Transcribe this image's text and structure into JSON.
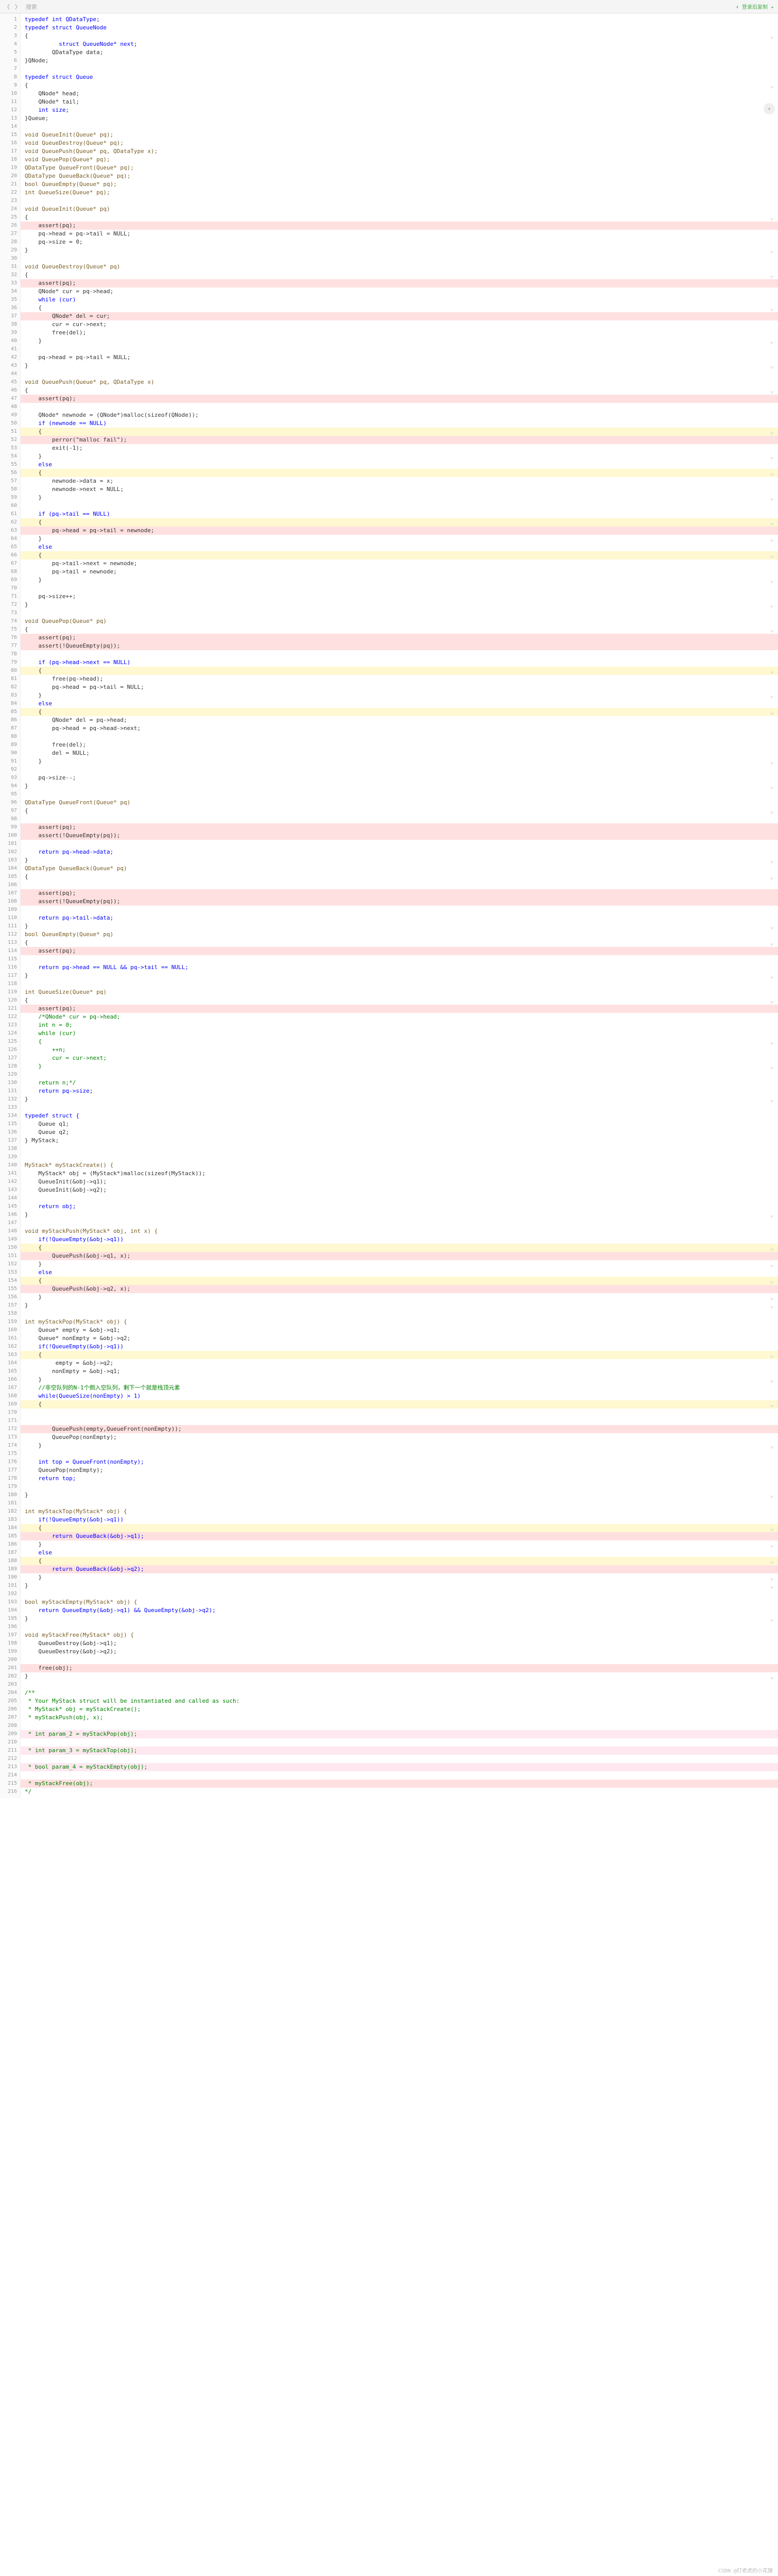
{
  "topbar": {
    "back": "〈",
    "fwd": "〉",
    "search": "搜索",
    "right": "⬇ 登录后复制   ✦"
  },
  "badge": "✦",
  "footer": "CSDN @打老虎的小花狸",
  "code": [
    {
      "n": 1,
      "t": "typedef int QDataType;",
      "c": "kw"
    },
    {
      "n": 2,
      "t": "typedef struct QueueNode",
      "c": "kw"
    },
    {
      "n": 3,
      "t": "{",
      "c": ""
    },
    {
      "n": 4,
      "t": "          struct QueueNode* next;",
      "c": "kw"
    },
    {
      "n": 5,
      "t": "        QDataType data;",
      "c": ""
    },
    {
      "n": 6,
      "t": "}QNode;",
      "c": ""
    },
    {
      "n": 7,
      "t": "",
      "c": ""
    },
    {
      "n": 8,
      "t": "typedef struct Queue",
      "c": "kw"
    },
    {
      "n": 9,
      "t": "{",
      "c": ""
    },
    {
      "n": 10,
      "t": "    QNode* head;",
      "c": ""
    },
    {
      "n": 11,
      "t": "    QNode* tail;",
      "c": ""
    },
    {
      "n": 12,
      "t": "    int size;",
      "c": "kw"
    },
    {
      "n": 13,
      "t": "}Queue;",
      "c": ""
    },
    {
      "n": 14,
      "t": "",
      "c": ""
    },
    {
      "n": 15,
      "t": "void QueueInit(Queue* pq);",
      "c": "fn"
    },
    {
      "n": 16,
      "t": "void QueueDestroy(Queue* pq);",
      "c": "fn"
    },
    {
      "n": 17,
      "t": "void QueuePush(Queue* pq, QDataType x);",
      "c": "fn"
    },
    {
      "n": 18,
      "t": "void QueuePop(Queue* pq);",
      "c": "fn"
    },
    {
      "n": 19,
      "t": "QDataType QueueFront(Queue* pq);",
      "c": "fn"
    },
    {
      "n": 20,
      "t": "QDataType QueueBack(Queue* pq);",
      "c": "fn"
    },
    {
      "n": 21,
      "t": "bool QueueEmpty(Queue* pq);",
      "c": "fn"
    },
    {
      "n": 22,
      "t": "int QueueSize(Queue* pq);",
      "c": "fn"
    },
    {
      "n": 23,
      "t": "",
      "c": ""
    },
    {
      "n": 24,
      "t": "void QueueInit(Queue* pq)",
      "c": "fn"
    },
    {
      "n": 25,
      "t": "{",
      "c": ""
    },
    {
      "n": 26,
      "t": "    assert(pq);",
      "c": "",
      "hl": "red"
    },
    {
      "n": 27,
      "t": "    pq->head = pq->tail = NULL;",
      "c": ""
    },
    {
      "n": 28,
      "t": "    pq->size = 0;",
      "c": ""
    },
    {
      "n": 29,
      "t": "}",
      "c": ""
    },
    {
      "n": 30,
      "t": "",
      "c": ""
    },
    {
      "n": 31,
      "t": "void QueueDestroy(Queue* pq)",
      "c": "fn"
    },
    {
      "n": 32,
      "t": "{",
      "c": ""
    },
    {
      "n": 33,
      "t": "    assert(pq);",
      "c": "",
      "hl": "red"
    },
    {
      "n": 34,
      "t": "    QNode* cur = pq->head;",
      "c": ""
    },
    {
      "n": 35,
      "t": "    while (cur)",
      "c": "kw"
    },
    {
      "n": 36,
      "t": "    {",
      "c": ""
    },
    {
      "n": 37,
      "t": "        QNode* del = cur;",
      "c": "",
      "hl": "red"
    },
    {
      "n": 38,
      "t": "        cur = cur->next;",
      "c": ""
    },
    {
      "n": 39,
      "t": "        free(del);",
      "c": ""
    },
    {
      "n": 40,
      "t": "    }",
      "c": ""
    },
    {
      "n": 41,
      "t": "",
      "c": ""
    },
    {
      "n": 42,
      "t": "    pq->head = pq->tail = NULL;",
      "c": ""
    },
    {
      "n": 43,
      "t": "}",
      "c": ""
    },
    {
      "n": 44,
      "t": "",
      "c": ""
    },
    {
      "n": 45,
      "t": "void QueuePush(Queue* pq, QDataType x)",
      "c": "fn"
    },
    {
      "n": 46,
      "t": "{",
      "c": ""
    },
    {
      "n": 47,
      "t": "    assert(pq);",
      "c": "",
      "hl": "red"
    },
    {
      "n": 48,
      "t": "",
      "c": ""
    },
    {
      "n": 49,
      "t": "    QNode* newnode = (QNode*)malloc(sizeof(QNode));",
      "c": ""
    },
    {
      "n": 50,
      "t": "    if (newnode == NULL)",
      "c": "kw"
    },
    {
      "n": 51,
      "t": "    {",
      "c": "",
      "hl": "yellow"
    },
    {
      "n": 52,
      "t": "        perror(\"malloc fail\");",
      "c": "",
      "hl": "red"
    },
    {
      "n": 53,
      "t": "        exit(-1);",
      "c": ""
    },
    {
      "n": 54,
      "t": "    }",
      "c": ""
    },
    {
      "n": 55,
      "t": "    else",
      "c": "kw"
    },
    {
      "n": 56,
      "t": "    {",
      "c": "",
      "hl": "yellow"
    },
    {
      "n": 57,
      "t": "        newnode->data = x;",
      "c": ""
    },
    {
      "n": 58,
      "t": "        newnode->next = NULL;",
      "c": ""
    },
    {
      "n": 59,
      "t": "    }",
      "c": ""
    },
    {
      "n": 60,
      "t": "",
      "c": ""
    },
    {
      "n": 61,
      "t": "    if (pq->tail == NULL)",
      "c": "kw"
    },
    {
      "n": 62,
      "t": "    {",
      "c": "",
      "hl": "yellow"
    },
    {
      "n": 63,
      "t": "        pq->head = pq->tail = newnode;",
      "c": "",
      "hl": "red"
    },
    {
      "n": 64,
      "t": "    }",
      "c": ""
    },
    {
      "n": 65,
      "t": "    else",
      "c": "kw"
    },
    {
      "n": 66,
      "t": "    {",
      "c": "",
      "hl": "yellow"
    },
    {
      "n": 67,
      "t": "        pq->tail->next = newnode;",
      "c": ""
    },
    {
      "n": 68,
      "t": "        pq->tail = newnode;",
      "c": ""
    },
    {
      "n": 69,
      "t": "    }",
      "c": ""
    },
    {
      "n": 70,
      "t": "",
      "c": ""
    },
    {
      "n": 71,
      "t": "    pq->size++;",
      "c": ""
    },
    {
      "n": 72,
      "t": "}",
      "c": ""
    },
    {
      "n": 73,
      "t": "",
      "c": ""
    },
    {
      "n": 74,
      "t": "void QueuePop(Queue* pq)",
      "c": "fn"
    },
    {
      "n": 75,
      "t": "{",
      "c": ""
    },
    {
      "n": 76,
      "t": "    assert(pq);",
      "c": "",
      "hl": "red"
    },
    {
      "n": 77,
      "t": "    assert(!QueueEmpty(pq));",
      "c": "",
      "hl": "red"
    },
    {
      "n": 78,
      "t": "",
      "c": ""
    },
    {
      "n": 79,
      "t": "    if (pq->head->next == NULL)",
      "c": "kw"
    },
    {
      "n": 80,
      "t": "    {",
      "c": "",
      "hl": "yellow"
    },
    {
      "n": 81,
      "t": "        free(pq->head);",
      "c": ""
    },
    {
      "n": 82,
      "t": "        pq->head = pq->tail = NULL;",
      "c": ""
    },
    {
      "n": 83,
      "t": "    }",
      "c": ""
    },
    {
      "n": 84,
      "t": "    else",
      "c": "kw"
    },
    {
      "n": 85,
      "t": "    {",
      "c": "",
      "hl": "yellow"
    },
    {
      "n": 86,
      "t": "        QNode* del = pq->head;",
      "c": ""
    },
    {
      "n": 87,
      "t": "        pq->head = pq->head->next;",
      "c": ""
    },
    {
      "n": 88,
      "t": "",
      "c": ""
    },
    {
      "n": 89,
      "t": "        free(del);",
      "c": ""
    },
    {
      "n": 90,
      "t": "        del = NULL;",
      "c": ""
    },
    {
      "n": 91,
      "t": "    }",
      "c": ""
    },
    {
      "n": 92,
      "t": "",
      "c": ""
    },
    {
      "n": 93,
      "t": "    pq->size--;",
      "c": ""
    },
    {
      "n": 94,
      "t": "}",
      "c": ""
    },
    {
      "n": 95,
      "t": "",
      "c": ""
    },
    {
      "n": 96,
      "t": "QDataType QueueFront(Queue* pq)",
      "c": "fn"
    },
    {
      "n": 97,
      "t": "{",
      "c": ""
    },
    {
      "n": 98,
      "t": "",
      "c": ""
    },
    {
      "n": 99,
      "t": "    assert(pq);",
      "c": "",
      "hl": "red"
    },
    {
      "n": 100,
      "t": "    assert(!QueueEmpty(pq));",
      "c": "",
      "hl": "red"
    },
    {
      "n": 101,
      "t": "",
      "c": ""
    },
    {
      "n": 102,
      "t": "    return pq->head->data;",
      "c": "kw"
    },
    {
      "n": 103,
      "t": "}",
      "c": ""
    },
    {
      "n": 104,
      "t": "QDataType QueueBack(Queue* pq)",
      "c": "fn"
    },
    {
      "n": 105,
      "t": "{",
      "c": ""
    },
    {
      "n": 106,
      "t": "",
      "c": ""
    },
    {
      "n": 107,
      "t": "    assert(pq);",
      "c": "",
      "hl": "red"
    },
    {
      "n": 108,
      "t": "    assert(!QueueEmpty(pq));",
      "c": "",
      "hl": "red"
    },
    {
      "n": 109,
      "t": "",
      "c": ""
    },
    {
      "n": 110,
      "t": "    return pq->tail->data;",
      "c": "kw"
    },
    {
      "n": 111,
      "t": "}",
      "c": ""
    },
    {
      "n": 112,
      "t": "bool QueueEmpty(Queue* pq)",
      "c": "fn"
    },
    {
      "n": 113,
      "t": "{",
      "c": ""
    },
    {
      "n": 114,
      "t": "    assert(pq);",
      "c": "",
      "hl": "red"
    },
    {
      "n": 115,
      "t": "",
      "c": ""
    },
    {
      "n": 116,
      "t": "    return pq->head == NULL && pq->tail == NULL;",
      "c": "kw"
    },
    {
      "n": 117,
      "t": "}",
      "c": ""
    },
    {
      "n": 118,
      "t": "",
      "c": ""
    },
    {
      "n": 119,
      "t": "int QueueSize(Queue* pq)",
      "c": "fn"
    },
    {
      "n": 120,
      "t": "{",
      "c": ""
    },
    {
      "n": 121,
      "t": "    assert(pq);",
      "c": "",
      "hl": "red"
    },
    {
      "n": 122,
      "t": "    /*QNode* cur = pq->head;",
      "c": "cmt"
    },
    {
      "n": 123,
      "t": "    int n = 0;",
      "c": "cmt"
    },
    {
      "n": 124,
      "t": "    while (cur)",
      "c": "cmt"
    },
    {
      "n": 125,
      "t": "    {",
      "c": "cmt"
    },
    {
      "n": 126,
      "t": "        ++n;",
      "c": "cmt"
    },
    {
      "n": 127,
      "t": "        cur = cur->next;",
      "c": "cmt"
    },
    {
      "n": 128,
      "t": "    }",
      "c": "cmt"
    },
    {
      "n": 129,
      "t": "",
      "c": ""
    },
    {
      "n": 130,
      "t": "    return n;*/",
      "c": "cmt"
    },
    {
      "n": 131,
      "t": "    return pq->size;",
      "c": "kw"
    },
    {
      "n": 132,
      "t": "}",
      "c": ""
    },
    {
      "n": 133,
      "t": "",
      "c": ""
    },
    {
      "n": 134,
      "t": "typedef struct {",
      "c": "kw"
    },
    {
      "n": 135,
      "t": "    Queue q1;",
      "c": ""
    },
    {
      "n": 136,
      "t": "    Queue q2;",
      "c": ""
    },
    {
      "n": 137,
      "t": "} MyStack;",
      "c": ""
    },
    {
      "n": 138,
      "t": "",
      "c": ""
    },
    {
      "n": 139,
      "t": "",
      "c": ""
    },
    {
      "n": 140,
      "t": "MyStack* myStackCreate() {",
      "c": "fn"
    },
    {
      "n": 141,
      "t": "    MyStack* obj = (MyStack*)malloc(sizeof(MyStack));",
      "c": ""
    },
    {
      "n": 142,
      "t": "    QueueInit(&obj->q1);",
      "c": ""
    },
    {
      "n": 143,
      "t": "    QueueInit(&obj->q2);",
      "c": ""
    },
    {
      "n": 144,
      "t": "",
      "c": ""
    },
    {
      "n": 145,
      "t": "    return obj;",
      "c": "kw"
    },
    {
      "n": 146,
      "t": "}",
      "c": ""
    },
    {
      "n": 147,
      "t": "",
      "c": ""
    },
    {
      "n": 148,
      "t": "void myStackPush(MyStack* obj, int x) {",
      "c": "fn"
    },
    {
      "n": 149,
      "t": "    if(!QueueEmpty(&obj->q1))",
      "c": "kw"
    },
    {
      "n": 150,
      "t": "    {",
      "c": "",
      "hl": "yellow"
    },
    {
      "n": 151,
      "t": "        QueuePush(&obj->q1, x);",
      "c": "",
      "hl": "red"
    },
    {
      "n": 152,
      "t": "    }",
      "c": ""
    },
    {
      "n": 153,
      "t": "    else",
      "c": "kw"
    },
    {
      "n": 154,
      "t": "    {",
      "c": "",
      "hl": "yellow"
    },
    {
      "n": 155,
      "t": "        QueuePush(&obj->q2, x);",
      "c": "",
      "hl": "red"
    },
    {
      "n": 156,
      "t": "    }",
      "c": ""
    },
    {
      "n": 157,
      "t": "}",
      "c": ""
    },
    {
      "n": 158,
      "t": "",
      "c": ""
    },
    {
      "n": 159,
      "t": "int myStackPop(MyStack* obj) {",
      "c": "fn"
    },
    {
      "n": 160,
      "t": "    Queue* empty = &obj->q1;",
      "c": ""
    },
    {
      "n": 161,
      "t": "    Queue* nonEmpty = &obj->q2;",
      "c": ""
    },
    {
      "n": 162,
      "t": "    if(!QueueEmpty(&obj->q1))",
      "c": "kw"
    },
    {
      "n": 163,
      "t": "    {",
      "c": "",
      "hl": "yellow"
    },
    {
      "n": 164,
      "t": "         empty = &obj->q2;",
      "c": ""
    },
    {
      "n": 165,
      "t": "        nonEmpty = &obj->q1;",
      "c": ""
    },
    {
      "n": 166,
      "t": "    }",
      "c": ""
    },
    {
      "n": 167,
      "t": "    //非空队列的N-1个倒入空队列，剩下一个就是栈顶元素",
      "c": "cmt"
    },
    {
      "n": 168,
      "t": "    while(QueueSize(nonEmpty) > 1)",
      "c": "kw"
    },
    {
      "n": 169,
      "t": "    {",
      "c": "",
      "hl": "yellow"
    },
    {
      "n": 170,
      "t": "",
      "c": ""
    },
    {
      "n": 171,
      "t": "",
      "c": ""
    },
    {
      "n": 172,
      "t": "        QueuePush(empty,QueueFront(nonEmpty));",
      "c": "",
      "hl": "red"
    },
    {
      "n": 173,
      "t": "        QueuePop(nonEmpty);",
      "c": ""
    },
    {
      "n": 174,
      "t": "    }",
      "c": ""
    },
    {
      "n": 175,
      "t": "",
      "c": ""
    },
    {
      "n": 176,
      "t": "    int top = QueueFront(nonEmpty);",
      "c": "kw"
    },
    {
      "n": 177,
      "t": "    QueuePop(nonEmpty);",
      "c": ""
    },
    {
      "n": 178,
      "t": "    return top;",
      "c": "kw"
    },
    {
      "n": 179,
      "t": "",
      "c": ""
    },
    {
      "n": 180,
      "t": "}",
      "c": ""
    },
    {
      "n": 181,
      "t": "",
      "c": ""
    },
    {
      "n": 182,
      "t": "int myStackTop(MyStack* obj) {",
      "c": "fn"
    },
    {
      "n": 183,
      "t": "    if(!QueueEmpty(&obj->q1))",
      "c": "kw"
    },
    {
      "n": 184,
      "t": "    {",
      "c": "",
      "hl": "yellow"
    },
    {
      "n": 185,
      "t": "        return QueueBack(&obj->q1);",
      "c": "kw",
      "hl": "red"
    },
    {
      "n": 186,
      "t": "    }",
      "c": ""
    },
    {
      "n": 187,
      "t": "    else",
      "c": "kw"
    },
    {
      "n": 188,
      "t": "    {",
      "c": "",
      "hl": "yellow"
    },
    {
      "n": 189,
      "t": "        return QueueBack(&obj->q2);",
      "c": "kw",
      "hl": "red"
    },
    {
      "n": 190,
      "t": "    }",
      "c": ""
    },
    {
      "n": 191,
      "t": "}",
      "c": ""
    },
    {
      "n": 192,
      "t": "",
      "c": ""
    },
    {
      "n": 193,
      "t": "bool myStackEmpty(MyStack* obj) {",
      "c": "fn"
    },
    {
      "n": 194,
      "t": "    return QueueEmpty(&obj->q1) && QueueEmpty(&obj->q2);",
      "c": "kw"
    },
    {
      "n": 195,
      "t": "}",
      "c": ""
    },
    {
      "n": 196,
      "t": "",
      "c": ""
    },
    {
      "n": 197,
      "t": "void myStackFree(MyStack* obj) {",
      "c": "fn"
    },
    {
      "n": 198,
      "t": "    QueueDestroy(&obj->q1);",
      "c": ""
    },
    {
      "n": 199,
      "t": "    QueueDestroy(&obj->q2);",
      "c": ""
    },
    {
      "n": 200,
      "t": "",
      "c": ""
    },
    {
      "n": 201,
      "t": "    free(obj);",
      "c": "",
      "hl": "red"
    },
    {
      "n": 202,
      "t": "}",
      "c": ""
    },
    {
      "n": 203,
      "t": "",
      "c": ""
    },
    {
      "n": 204,
      "t": "/**",
      "c": "cmt"
    },
    {
      "n": 205,
      "t": " * Your MyStack struct will be instantiated and called as such:",
      "c": "cmt"
    },
    {
      "n": 206,
      "t": " * MyStack* obj = myStackCreate();",
      "c": "cmt"
    },
    {
      "n": 207,
      "t": " * myStackPush(obj, x);",
      "c": "cmt"
    },
    {
      "n": 208,
      "t": " ",
      "c": "cmt"
    },
    {
      "n": 209,
      "t": " * int param_2 = myStackPop(obj);",
      "c": "cmt",
      "hl": "pink"
    },
    {
      "n": 210,
      "t": " ",
      "c": "cmt"
    },
    {
      "n": 211,
      "t": " * int param_3 = myStackTop(obj);",
      "c": "cmt",
      "hl": "pink"
    },
    {
      "n": 212,
      "t": " ",
      "c": "cmt"
    },
    {
      "n": 213,
      "t": " * bool param_4 = myStackEmpty(obj);",
      "c": "cmt",
      "hl": "pink"
    },
    {
      "n": 214,
      "t": " ",
      "c": "cmt"
    },
    {
      "n": 215,
      "t": " * myStackFree(obj);",
      "c": "cmt",
      "hl": "red"
    },
    {
      "n": 216,
      "t": "*/",
      "c": "cmt"
    }
  ]
}
